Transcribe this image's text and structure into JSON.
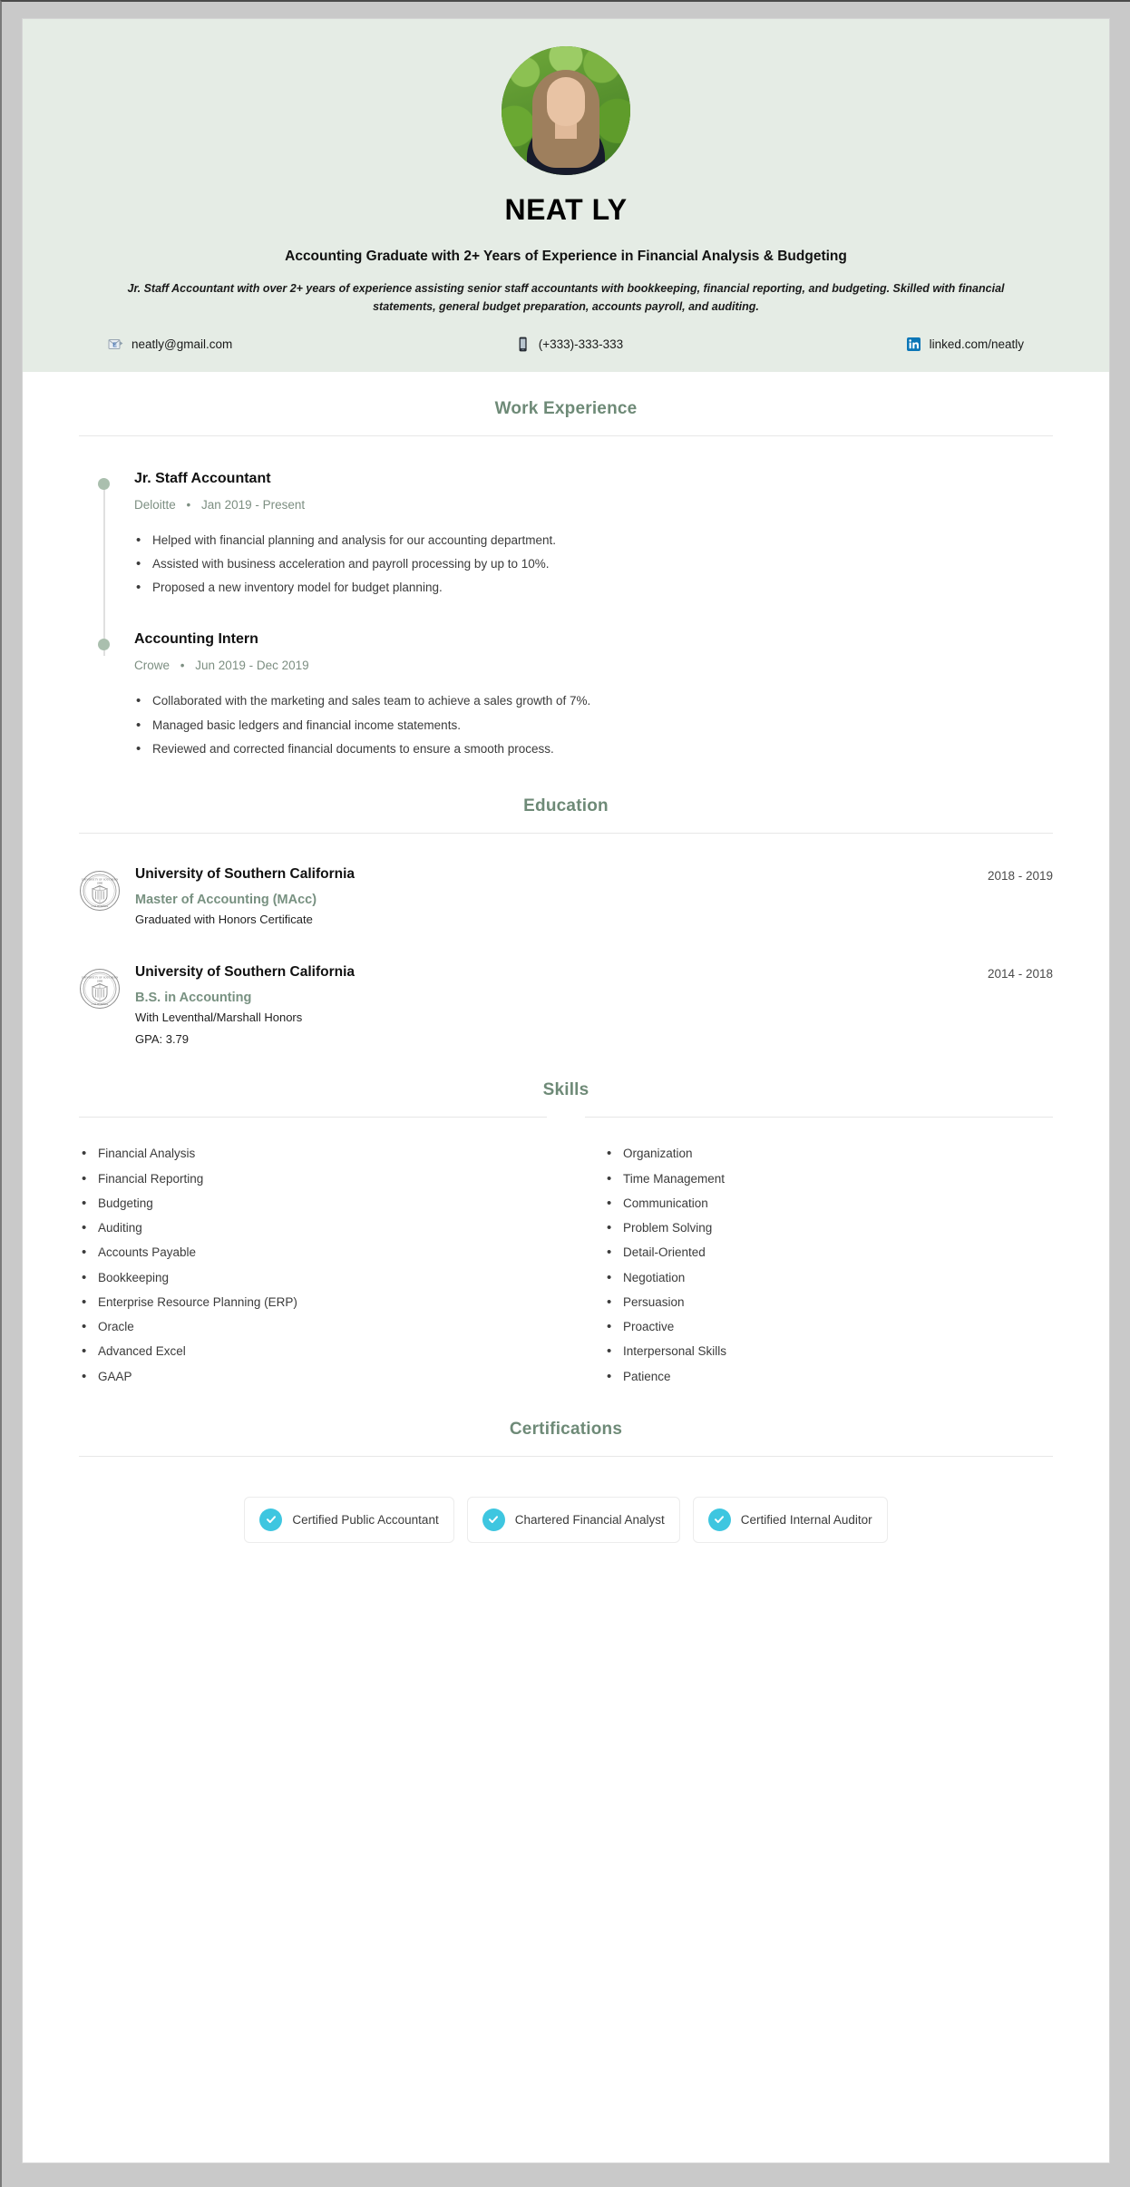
{
  "colors": {
    "header_bg": "#e5ece5",
    "accent_green": "#6e8a77",
    "muted_green": "#789181",
    "check_cyan": "#3ec6e0",
    "page_bg": "#ffffff",
    "canvas_bg": "#c9c9c9"
  },
  "header": {
    "avatar_alt": "profile-photo",
    "name": "NEAT LY",
    "headline": "Accounting Graduate with 2+ Years of Experience in Financial Analysis & Budgeting",
    "summary": "Jr. Staff Accountant with over 2+ years of experience assisting senior staff accountants with bookkeeping, financial reporting, and budgeting. Skilled with financial statements, general budget preparation, accounts payroll, and auditing.",
    "contacts": [
      {
        "icon": "email-icon",
        "value": "neatly@gmail.com"
      },
      {
        "icon": "phone-icon",
        "value": "(+333)-333-333"
      },
      {
        "icon": "linkedin-icon",
        "value": "linked.com/neatly"
      }
    ]
  },
  "sections": {
    "experience_title": "Work Experience",
    "education_title": "Education",
    "skills_title": "Skills",
    "certifications_title": "Certifications"
  },
  "experience": [
    {
      "title": "Jr. Staff Accountant",
      "company": "Deloitte",
      "separator": "•",
      "dates": "Jan 2019 - Present",
      "bullets": [
        "Helped with financial planning and analysis for our accounting department.",
        "Assisted with business acceleration and payroll processing by up to 10%.",
        "Proposed a new inventory model for budget planning."
      ]
    },
    {
      "title": "Accounting Intern",
      "company": "Crowe",
      "separator": "•",
      "dates": "Jun 2019 - Dec 2019",
      "bullets": [
        "Collaborated with the marketing and sales team to achieve a sales growth of 7%.",
        "Managed basic ledgers and financial income statements.",
        "Reviewed and corrected financial documents to ensure a smooth process."
      ]
    }
  ],
  "education": [
    {
      "logo": "usc-seal-icon",
      "school": "University of Southern California",
      "degree": "Master of Accounting (MAcc)",
      "notes": [
        "Graduated with Honors Certificate"
      ],
      "dates": "2018 - 2019"
    },
    {
      "logo": "usc-seal-icon",
      "school": "University of Southern California",
      "degree": "B.S. in Accounting",
      "notes": [
        "With Leventhal/Marshall Honors",
        "GPA: 3.79"
      ],
      "dates": "2014 - 2018"
    }
  ],
  "skills": {
    "left": [
      "Financial Analysis",
      "Financial Reporting",
      "Budgeting",
      "Auditing",
      "Accounts Payable",
      "Bookkeeping",
      "Enterprise Resource Planning (ERP)",
      "Oracle",
      "Advanced Excel",
      "GAAP"
    ],
    "right": [
      "Organization",
      "Time Management",
      "Communication",
      "Problem Solving",
      "Detail-Oriented",
      "Negotiation",
      "Persuasion",
      "Proactive",
      "Interpersonal Skills",
      "Patience"
    ]
  },
  "certifications": [
    {
      "icon": "check-circle-icon",
      "label": "Certified Public Accountant"
    },
    {
      "icon": "check-circle-icon",
      "label": "Chartered Financial Analyst"
    },
    {
      "icon": "check-circle-icon",
      "label": "Certified Internal Auditor"
    }
  ]
}
